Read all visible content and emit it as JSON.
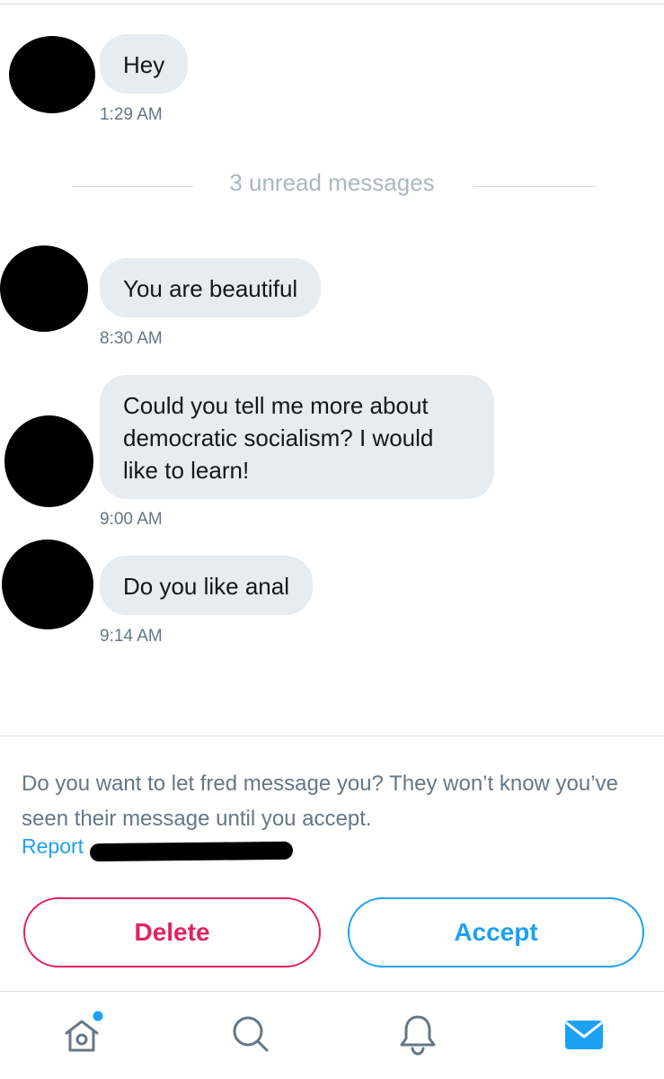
{
  "messages": [
    {
      "text": "Hey",
      "time": "1:29 AM"
    },
    {
      "text": "You are beautiful",
      "time": "8:30 AM"
    },
    {
      "text": "Could you tell me more about democratic socialism? I would like to learn!",
      "time": "9:00 AM"
    },
    {
      "text": "Do you like anal",
      "time": "9:14 AM"
    }
  ],
  "unread_divider": "3 unread messages",
  "request": {
    "prompt": "Do you want to let fred message you? They won’t know you’ve seen their message until you accept.",
    "report_label": "Report",
    "delete_label": "Delete",
    "accept_label": "Accept"
  },
  "tabbar": {
    "items": [
      "home-icon",
      "search-icon",
      "notifications-bell-icon",
      "messages-envelope-icon"
    ],
    "home_has_new_badge": true,
    "active_tab": "messages"
  },
  "colors": {
    "accent_blue": "#1da1f2",
    "delete_red": "#e0245e",
    "bubble_gray": "#e6ecf0",
    "secondary_text": "#657786"
  }
}
